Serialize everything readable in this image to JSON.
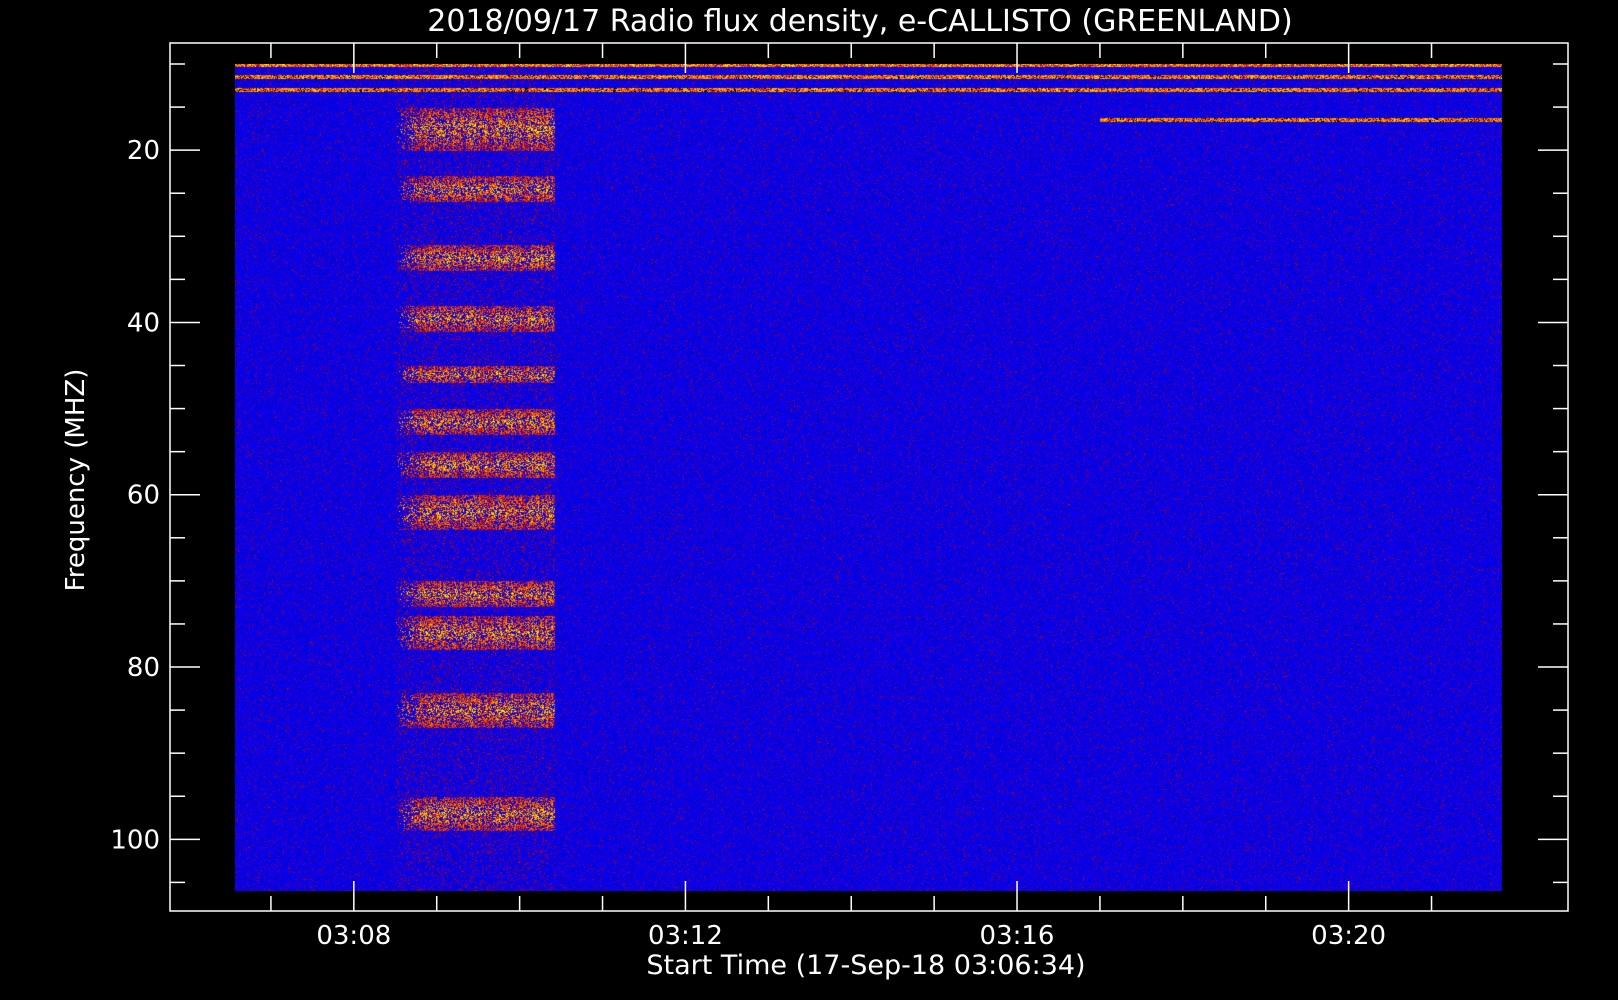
{
  "chart_data": {
    "type": "heatmap",
    "title": "2018/09/17  Radio flux density, e-CALLISTO (GREENLAND)",
    "xlabel": "Start Time (17-Sep-18 03:06:34)",
    "ylabel": "Frequency (MHZ)",
    "x_unit": "UT time",
    "y_unit": "MHz",
    "xlim": [
      "03:06:34",
      "03:21:51"
    ],
    "ylim": [
      10,
      106
    ],
    "y_inverted": true,
    "x_ticks": [
      "03:08",
      "03:12",
      "03:16",
      "03:20"
    ],
    "y_ticks": [
      20,
      40,
      60,
      80,
      100
    ],
    "colormap": [
      "#000000",
      "#0000ff",
      "#c80000",
      "#ff8000",
      "#ffff00"
    ],
    "background_level": "low (blue)",
    "features": [
      {
        "name": "burst",
        "t_start": "03:08:30",
        "t_end": "03:10:25",
        "f_min": 15,
        "f_max": 99,
        "bands_mhz": [
          [
            15,
            20
          ],
          [
            23,
            26
          ],
          [
            31,
            34
          ],
          [
            38,
            41
          ],
          [
            45,
            47
          ],
          [
            50,
            53
          ],
          [
            55,
            58
          ],
          [
            60,
            64
          ],
          [
            70,
            73
          ],
          [
            74,
            78
          ],
          [
            83,
            87
          ],
          [
            95,
            99
          ]
        ]
      },
      {
        "name": "rfi-line",
        "freq": 11.5
      },
      {
        "name": "rfi-line",
        "freq": 13
      },
      {
        "name": "rfi-line",
        "freq": 16.5,
        "t_start": "03:17:00",
        "t_end": "03:21:51"
      }
    ]
  },
  "colors": {
    "background": "#000000",
    "axes": "#ffffff",
    "text": "#ffffff"
  }
}
